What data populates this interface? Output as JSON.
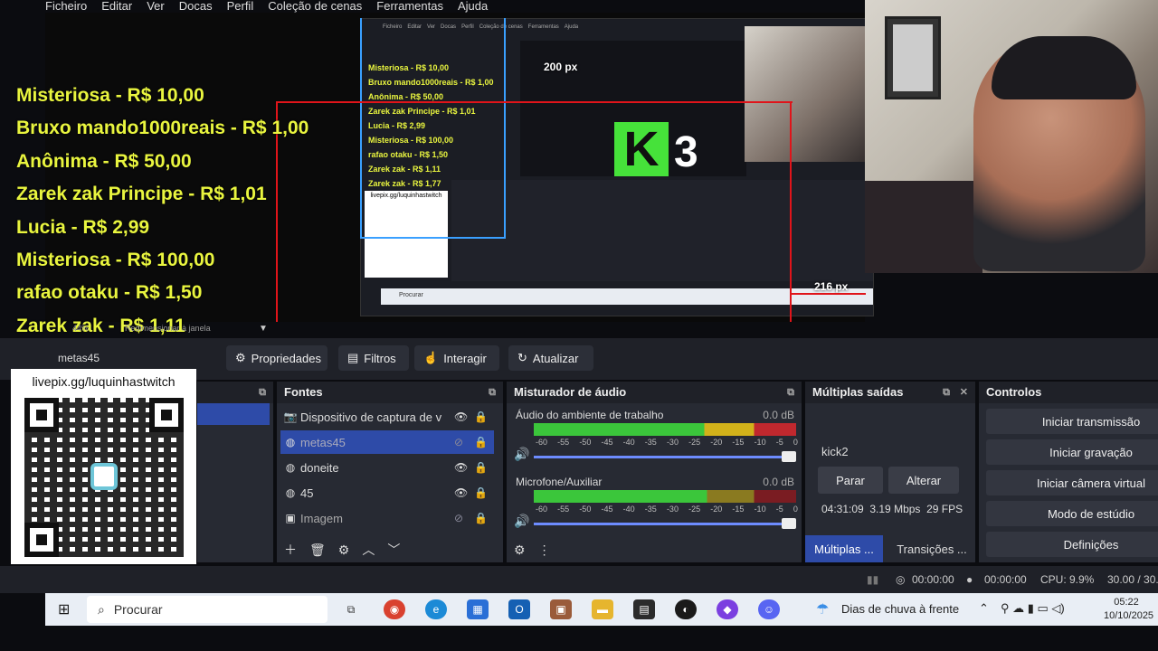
{
  "menu": [
    "Ficheiro",
    "Editar",
    "Ver",
    "Docas",
    "Perfil",
    "Coleção de cenas",
    "Ferramentas",
    "Ajuda"
  ],
  "donations": [
    "Misteriosa - R$ 10,00",
    "Bruxo mando1000reais - R$ 1,00",
    "Anônima - R$ 50,00",
    "Zarek zak Principe - R$ 1,01",
    "Lucia - R$ 2,99",
    "Misteriosa - R$ 100,00",
    "rafao otaku - R$ 1,50",
    "Zarek zak - R$ 1,11",
    "Zarek zak - R$ 1,77"
  ],
  "qr": {
    "url": "livepix.gg/luquinhastwitch"
  },
  "preview": {
    "labels": {
      "k_letter": "K",
      "num": "3",
      "px_top": "200 px",
      "px_bottom": "216 px"
    },
    "zoom": "44%",
    "resize_hint": "Redimensionar à janela"
  },
  "toolbar": {
    "selected_source": "metas45",
    "properties": "Propriedades",
    "filters": "Filtros",
    "interact": "Interagir",
    "refresh": "Atualizar"
  },
  "sources": {
    "title": "Fontes",
    "items": [
      {
        "label": "Dispositivo de captura de v",
        "icon": "camera-icon",
        "visible": true,
        "selected": false
      },
      {
        "label": "metas45",
        "icon": "browser-icon",
        "visible": false,
        "selected": true
      },
      {
        "label": "doneite",
        "icon": "browser-icon",
        "visible": true,
        "selected": false
      },
      {
        "label": "45",
        "icon": "browser-icon",
        "visible": true,
        "selected": false
      },
      {
        "label": "Imagem",
        "icon": "image-icon",
        "visible": false,
        "selected": false
      }
    ]
  },
  "mixer": {
    "title": "Misturador de áudio",
    "channels": [
      {
        "name": "Áudio do ambiente de trabalho",
        "db": "0.0 dB"
      },
      {
        "name": "Microfone/Auxiliar",
        "db": "0.0 dB"
      }
    ],
    "ticks": [
      "-60",
      "-55",
      "-50",
      "-45",
      "-40",
      "-35",
      "-30",
      "-25",
      "-20",
      "-15",
      "-10",
      "-5",
      "0"
    ]
  },
  "multi": {
    "title": "Múltiplas saídas",
    "name": "kick2",
    "stop": "Parar",
    "change": "Alterar",
    "stats": "04:31:09  3.19 Mbps  29 FPS",
    "tab_multi": "Múltiplas ...",
    "tab_transitions": "Transições ..."
  },
  "controls": {
    "title": "Controlos",
    "buttons": [
      "Iniciar transmissão",
      "Iniciar gravação",
      "Iniciar câmera virtual",
      "Modo de estúdio",
      "Definições"
    ]
  },
  "status": {
    "stream_time": "00:00:00",
    "rec_time": "00:00:00",
    "cpu": "CPU: 9.9%",
    "fps": "30.00 / 30."
  },
  "taskbar": {
    "search_placeholder": "Procurar",
    "weather": "Dias de chuva à frente",
    "time": "05:22",
    "date": "10/10/2025"
  },
  "colors": {
    "accent": "#2e4ba8",
    "donation_text": "#e9f53f",
    "guide_red": "#e0141a",
    "guide_blue": "#3aa0ff",
    "k_green": "#46e23a"
  }
}
